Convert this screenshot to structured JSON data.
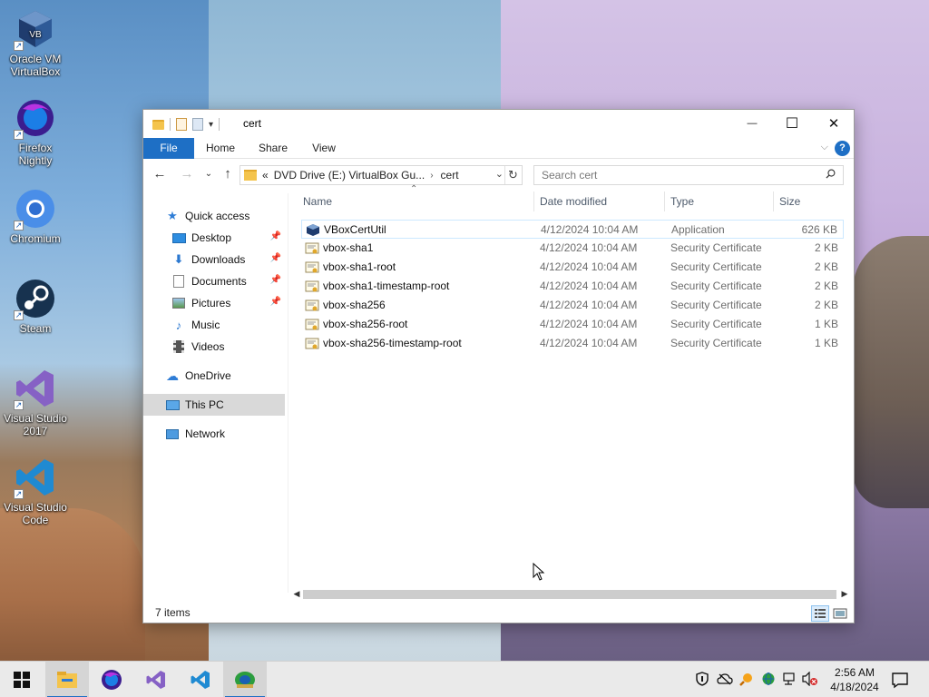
{
  "desktop": {
    "icons": [
      {
        "label": "Oracle VM VirtualBox",
        "icon": "virtualbox-icon"
      },
      {
        "label": "Firefox Nightly",
        "icon": "firefox-nightly-icon"
      },
      {
        "label": "Chromium",
        "icon": "chromium-icon"
      },
      {
        "label": "Steam",
        "icon": "steam-icon"
      },
      {
        "label": "Visual Studio 2017",
        "icon": "visual-studio-icon"
      },
      {
        "label": "Visual Studio Code",
        "icon": "vscode-icon"
      }
    ]
  },
  "window": {
    "title": "cert",
    "controls": {
      "minimize": "—",
      "maximize": "☐",
      "close": "✕"
    },
    "ribbon": {
      "tabs": [
        "File",
        "Home",
        "Share",
        "View"
      ],
      "help": "?"
    },
    "address": {
      "overflow": "«",
      "parts": [
        "DVD Drive (E:) VirtualBox Gu...",
        "cert"
      ]
    },
    "search": {
      "placeholder": "Search cert"
    },
    "nav_pane": {
      "quick_access": "Quick access",
      "quick_items": [
        {
          "label": "Desktop",
          "pinned": true
        },
        {
          "label": "Downloads",
          "pinned": true
        },
        {
          "label": "Documents",
          "pinned": true
        },
        {
          "label": "Pictures",
          "pinned": true
        },
        {
          "label": "Music",
          "pinned": false
        },
        {
          "label": "Videos",
          "pinned": false
        }
      ],
      "onedrive": "OneDrive",
      "this_pc": "This PC",
      "network": "Network"
    },
    "columns": {
      "name": "Name",
      "date": "Date modified",
      "type": "Type",
      "size": "Size"
    },
    "files": [
      {
        "name": "VBoxCertUtil",
        "date": "4/12/2024 10:04 AM",
        "type": "Application",
        "size": "626 KB",
        "icon": "application-icon"
      },
      {
        "name": "vbox-sha1",
        "date": "4/12/2024 10:04 AM",
        "type": "Security Certificate",
        "size": "2 KB",
        "icon": "certificate-icon"
      },
      {
        "name": "vbox-sha1-root",
        "date": "4/12/2024 10:04 AM",
        "type": "Security Certificate",
        "size": "2 KB",
        "icon": "certificate-icon"
      },
      {
        "name": "vbox-sha1-timestamp-root",
        "date": "4/12/2024 10:04 AM",
        "type": "Security Certificate",
        "size": "2 KB",
        "icon": "certificate-icon"
      },
      {
        "name": "vbox-sha256",
        "date": "4/12/2024 10:04 AM",
        "type": "Security Certificate",
        "size": "2 KB",
        "icon": "certificate-icon"
      },
      {
        "name": "vbox-sha256-root",
        "date": "4/12/2024 10:04 AM",
        "type": "Security Certificate",
        "size": "1 KB",
        "icon": "certificate-icon"
      },
      {
        "name": "vbox-sha256-timestamp-root",
        "date": "4/12/2024 10:04 AM",
        "type": "Security Certificate",
        "size": "1 KB",
        "icon": "certificate-icon"
      }
    ],
    "status": {
      "items": "7 items"
    }
  },
  "taskbar": {
    "apps": [
      "start-icon",
      "file-explorer-icon",
      "firefox-nightly-icon",
      "visual-studio-icon",
      "vscode-icon",
      "virtualbox-installer-icon"
    ],
    "clock": {
      "time": "2:56 AM",
      "date": "4/18/2024"
    }
  },
  "colors": {
    "accent": "#1e6fc5",
    "selection": "#cce8ff",
    "nav_selected": "#d9d9d9"
  }
}
